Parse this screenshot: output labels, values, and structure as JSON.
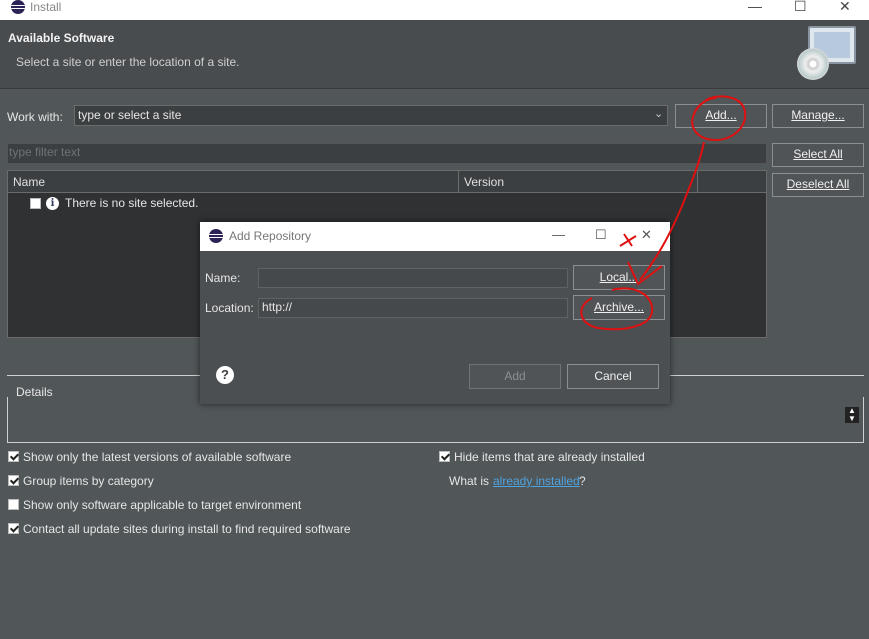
{
  "window": {
    "title": "Install",
    "controls": [
      "—",
      "☐",
      "✕"
    ]
  },
  "header": {
    "title": "Available Software",
    "subtitle": "Select a site or enter the location of a site."
  },
  "work_with": {
    "label": "Work with:",
    "value": "type or select a site",
    "add_button": "Add...",
    "manage_button": "Manage..."
  },
  "filter": {
    "placeholder": "type filter text"
  },
  "buttons": {
    "select_all": "Select All",
    "deselect_all": "Deselect All"
  },
  "table": {
    "columns": [
      "Name",
      "Version"
    ],
    "rows": [
      {
        "text": "There is no site selected.",
        "checked": false
      }
    ]
  },
  "details": {
    "label": "Details"
  },
  "options_left": [
    {
      "label": "Show only the latest versions of available software",
      "checked": true
    },
    {
      "label": "Group items by category",
      "checked": true
    },
    {
      "label": "Show only software applicable to target environment",
      "checked": false
    },
    {
      "label": "Contact all update sites during install to find required software",
      "checked": true
    }
  ],
  "options_right": {
    "hide_installed": {
      "label": "Hide items that are already installed",
      "checked": true
    },
    "what_is": "What is",
    "link": "already installed",
    "question": "?"
  },
  "dialog": {
    "title": "Add Repository",
    "name_label": "Name:",
    "name_value": "",
    "location_label": "Location:",
    "location_value": "http://",
    "local_button": "Local...",
    "archive_button": "Archive...",
    "add_button": "Add",
    "cancel_button": "Cancel",
    "controls": [
      "—",
      "☐",
      "✕"
    ]
  },
  "colors": {
    "background": "#515658",
    "annotation": "#e01010",
    "link": "#4fa3e0"
  }
}
